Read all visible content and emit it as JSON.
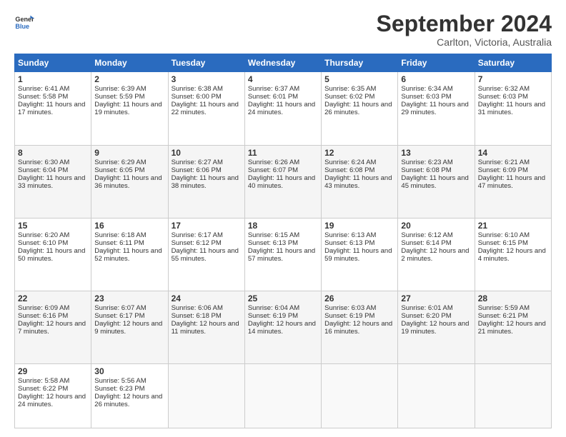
{
  "logo": {
    "line1": "General",
    "line2": "Blue"
  },
  "header": {
    "month": "September 2024",
    "location": "Carlton, Victoria, Australia"
  },
  "weekdays": [
    "Sunday",
    "Monday",
    "Tuesday",
    "Wednesday",
    "Thursday",
    "Friday",
    "Saturday"
  ],
  "weeks": [
    [
      {
        "day": 1,
        "rise": "6:41 AM",
        "set": "5:58 PM",
        "hours": "11 hours and 17 minutes."
      },
      {
        "day": 2,
        "rise": "6:39 AM",
        "set": "5:59 PM",
        "hours": "11 hours and 19 minutes."
      },
      {
        "day": 3,
        "rise": "6:38 AM",
        "set": "6:00 PM",
        "hours": "11 hours and 22 minutes."
      },
      {
        "day": 4,
        "rise": "6:37 AM",
        "set": "6:01 PM",
        "hours": "11 hours and 24 minutes."
      },
      {
        "day": 5,
        "rise": "6:35 AM",
        "set": "6:02 PM",
        "hours": "11 hours and 26 minutes."
      },
      {
        "day": 6,
        "rise": "6:34 AM",
        "set": "6:03 PM",
        "hours": "11 hours and 29 minutes."
      },
      {
        "day": 7,
        "rise": "6:32 AM",
        "set": "6:03 PM",
        "hours": "11 hours and 31 minutes."
      }
    ],
    [
      {
        "day": 8,
        "rise": "6:30 AM",
        "set": "6:04 PM",
        "hours": "11 hours and 33 minutes."
      },
      {
        "day": 9,
        "rise": "6:29 AM",
        "set": "6:05 PM",
        "hours": "11 hours and 36 minutes."
      },
      {
        "day": 10,
        "rise": "6:27 AM",
        "set": "6:06 PM",
        "hours": "11 hours and 38 minutes."
      },
      {
        "day": 11,
        "rise": "6:26 AM",
        "set": "6:07 PM",
        "hours": "11 hours and 40 minutes."
      },
      {
        "day": 12,
        "rise": "6:24 AM",
        "set": "6:08 PM",
        "hours": "11 hours and 43 minutes."
      },
      {
        "day": 13,
        "rise": "6:23 AM",
        "set": "6:08 PM",
        "hours": "11 hours and 45 minutes."
      },
      {
        "day": 14,
        "rise": "6:21 AM",
        "set": "6:09 PM",
        "hours": "11 hours and 47 minutes."
      }
    ],
    [
      {
        "day": 15,
        "rise": "6:20 AM",
        "set": "6:10 PM",
        "hours": "11 hours and 50 minutes."
      },
      {
        "day": 16,
        "rise": "6:18 AM",
        "set": "6:11 PM",
        "hours": "11 hours and 52 minutes."
      },
      {
        "day": 17,
        "rise": "6:17 AM",
        "set": "6:12 PM",
        "hours": "11 hours and 55 minutes."
      },
      {
        "day": 18,
        "rise": "6:15 AM",
        "set": "6:13 PM",
        "hours": "11 hours and 57 minutes."
      },
      {
        "day": 19,
        "rise": "6:13 AM",
        "set": "6:13 PM",
        "hours": "11 hours and 59 minutes."
      },
      {
        "day": 20,
        "rise": "6:12 AM",
        "set": "6:14 PM",
        "hours": "12 hours and 2 minutes."
      },
      {
        "day": 21,
        "rise": "6:10 AM",
        "set": "6:15 PM",
        "hours": "12 hours and 4 minutes."
      }
    ],
    [
      {
        "day": 22,
        "rise": "6:09 AM",
        "set": "6:16 PM",
        "hours": "12 hours and 7 minutes."
      },
      {
        "day": 23,
        "rise": "6:07 AM",
        "set": "6:17 PM",
        "hours": "12 hours and 9 minutes."
      },
      {
        "day": 24,
        "rise": "6:06 AM",
        "set": "6:18 PM",
        "hours": "12 hours and 11 minutes."
      },
      {
        "day": 25,
        "rise": "6:04 AM",
        "set": "6:19 PM",
        "hours": "12 hours and 14 minutes."
      },
      {
        "day": 26,
        "rise": "6:03 AM",
        "set": "6:19 PM",
        "hours": "12 hours and 16 minutes."
      },
      {
        "day": 27,
        "rise": "6:01 AM",
        "set": "6:20 PM",
        "hours": "12 hours and 19 minutes."
      },
      {
        "day": 28,
        "rise": "5:59 AM",
        "set": "6:21 PM",
        "hours": "12 hours and 21 minutes."
      }
    ],
    [
      {
        "day": 29,
        "rise": "5:58 AM",
        "set": "6:22 PM",
        "hours": "12 hours and 24 minutes."
      },
      {
        "day": 30,
        "rise": "5:56 AM",
        "set": "6:23 PM",
        "hours": "12 hours and 26 minutes."
      },
      null,
      null,
      null,
      null,
      null
    ]
  ]
}
